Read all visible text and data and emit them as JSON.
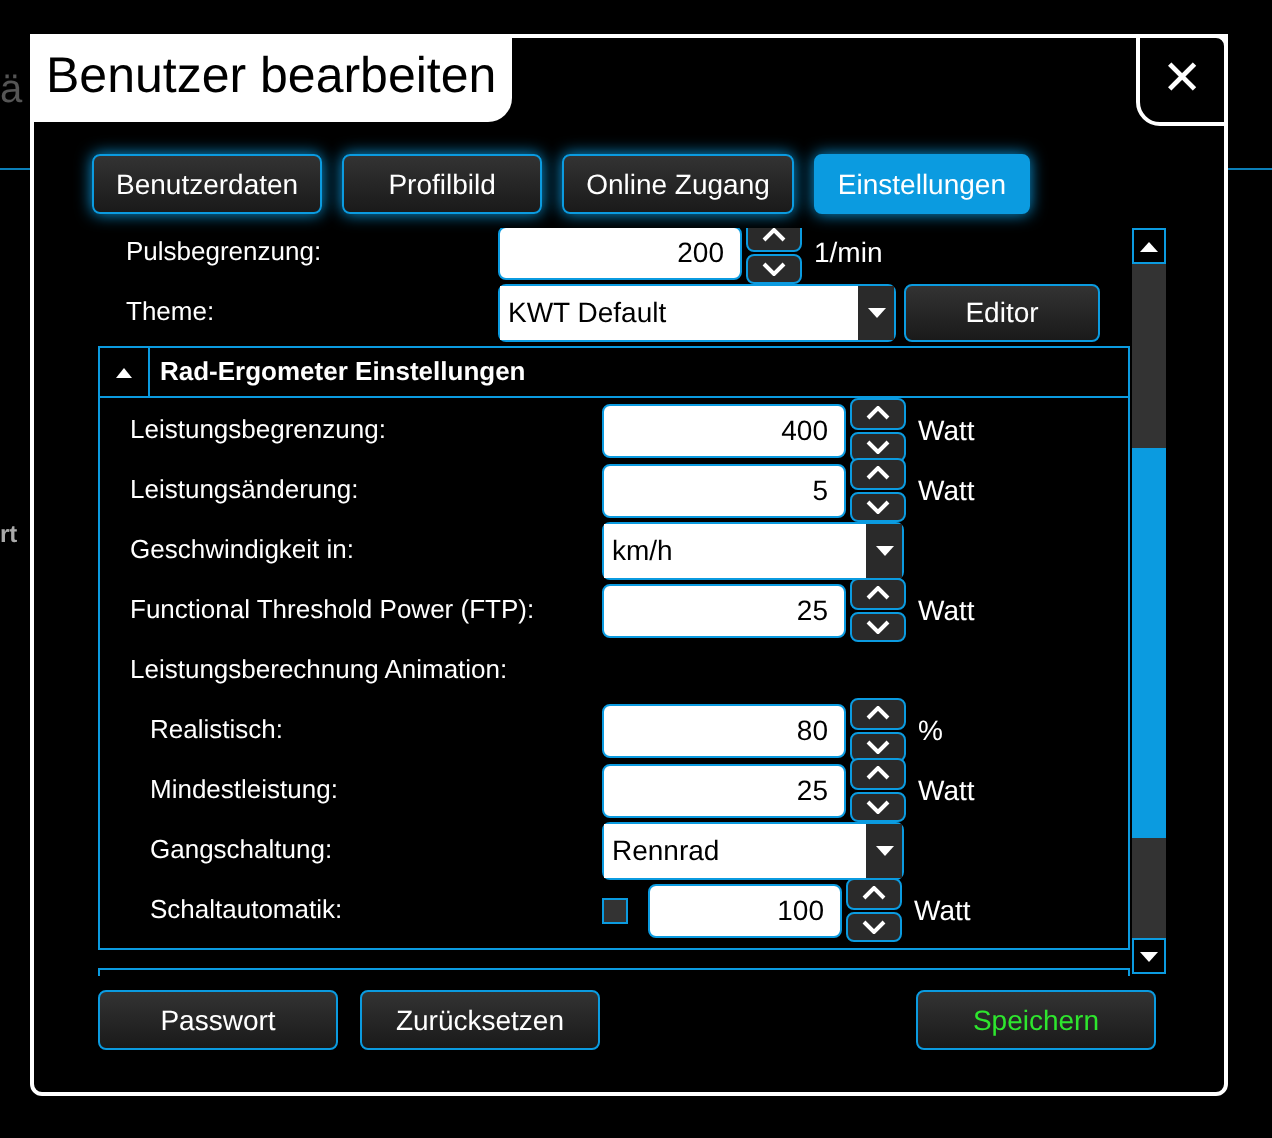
{
  "background": {
    "fragments": [
      "ä",
      "rt"
    ]
  },
  "window": {
    "title": "Benutzer bearbeiten",
    "close": "✕"
  },
  "tabs": [
    {
      "label": "Benutzerdaten",
      "selected": false
    },
    {
      "label": "Profilbild",
      "selected": false
    },
    {
      "label": "Online Zugang",
      "selected": false
    },
    {
      "label": "Einstellungen",
      "selected": true
    }
  ],
  "general": [
    {
      "kind": "number",
      "label": "Pulsbegrenzung:",
      "value": "200",
      "unit": "1/min"
    },
    {
      "kind": "select",
      "label": "Theme:",
      "value": "KWT Default",
      "button": "Editor"
    }
  ],
  "section": {
    "title": "Rad-Ergometer Einstellungen",
    "expanded": true,
    "rows": [
      {
        "kind": "number",
        "label": "Leistungsbegrenzung:",
        "value": "400",
        "unit": "Watt"
      },
      {
        "kind": "number",
        "label": "Leistungsänderung:",
        "value": "5",
        "unit": "Watt"
      },
      {
        "kind": "select",
        "label": "Geschwindigkeit in:",
        "value": "km/h"
      },
      {
        "kind": "number",
        "label": "Functional Threshold Power (FTP):",
        "value": "25",
        "unit": "Watt"
      },
      {
        "kind": "heading",
        "label": "Leistungsberechnung Animation:",
        "children": [
          {
            "kind": "number",
            "label": "Realistisch:",
            "value": "80",
            "unit": "%"
          },
          {
            "kind": "number",
            "label": "Mindestleistung:",
            "value": "25",
            "unit": "Watt"
          },
          {
            "kind": "select",
            "label": "Gangschaltung:",
            "value": "Rennrad"
          },
          {
            "kind": "checknumber",
            "label": "Schaltautomatik:",
            "checked": false,
            "value": "100",
            "unit": "Watt"
          }
        ]
      }
    ]
  },
  "buttons": [
    {
      "label": "Passwort",
      "kind": "normal"
    },
    {
      "label": "Zurücksetzen",
      "kind": "normal"
    },
    {
      "label": "Speichern",
      "kind": "save"
    }
  ]
}
